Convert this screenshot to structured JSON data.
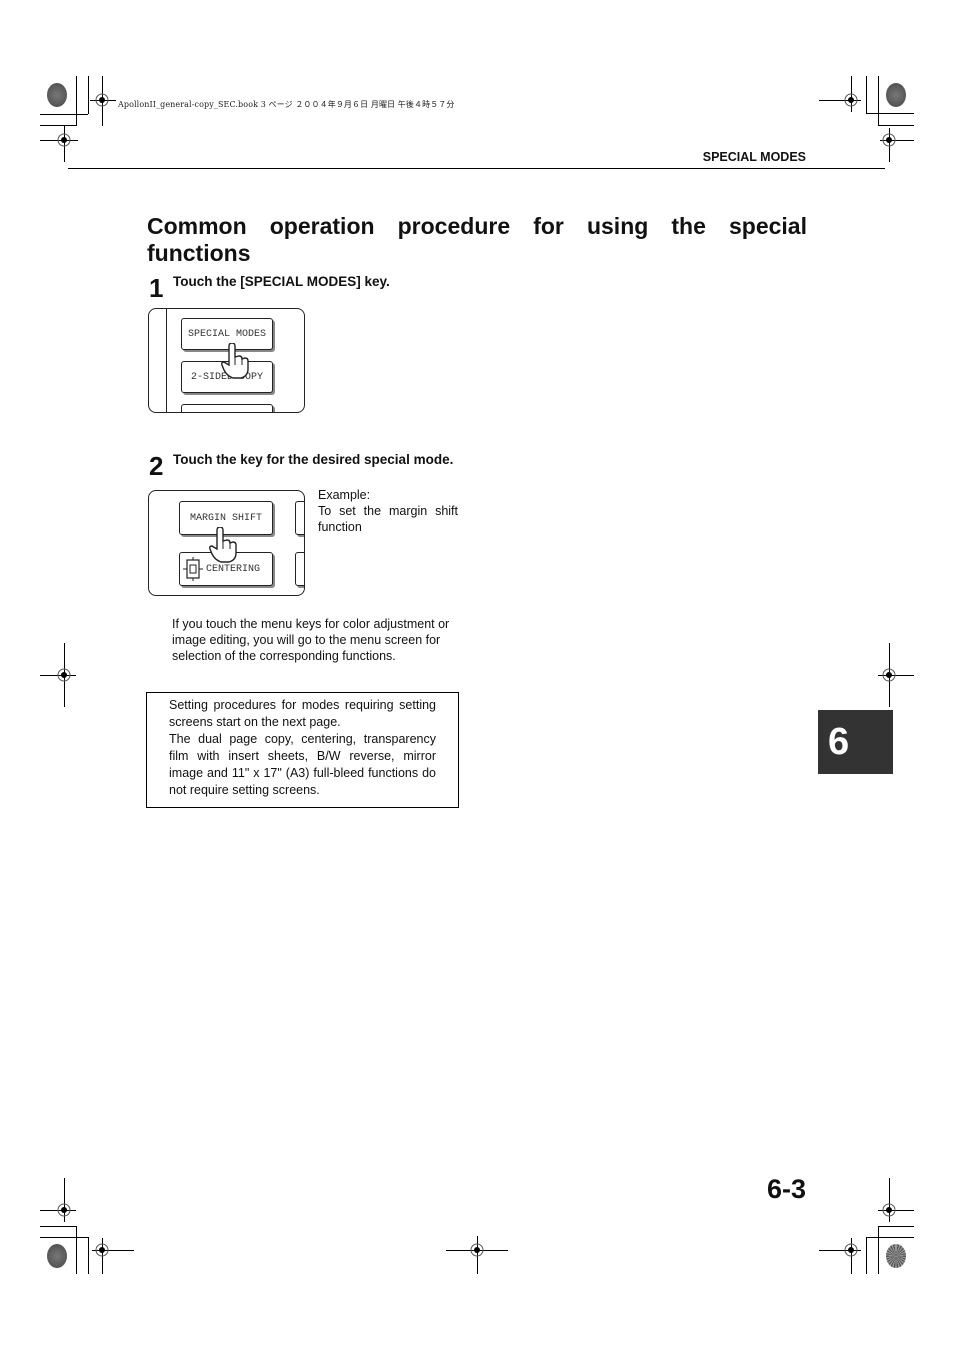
{
  "print_info": {
    "book_line": "ApollonII_general-copy_SEC.book  3 ページ  ２００４年９月６日  月曜日  午後４時５７分"
  },
  "header": {
    "running_head": "SPECIAL MODES"
  },
  "title": {
    "line1": "Common operation procedure for using the special",
    "line2": "functions"
  },
  "steps": [
    {
      "number": "1",
      "text": "Touch the [SPECIAL MODES] key.",
      "illustration": {
        "keys": [
          "SPECIAL MODES",
          "2-SIDED COPY"
        ],
        "icon": "hand-pointer-icon"
      }
    },
    {
      "number": "2",
      "text": "Touch the key for the desired special mode.",
      "illustration": {
        "keys": [
          "MARGIN SHIFT",
          "CENTERING"
        ],
        "icon": "hand-pointer-icon"
      },
      "example_label": "Example:",
      "example_text": "To set the margin shift function"
    }
  ],
  "note": "If you touch the menu keys for color adjustment or image editing, you will go to the menu screen for selection of the corresponding functions.",
  "info_box": {
    "line1": "Setting procedures for modes requiring setting screens start on the next page.",
    "line2": "The dual page copy, centering, transparency film with insert sheets, B/W reverse, mirror image and 11\" x 17\" (A3) full-bleed functions do not require setting screens."
  },
  "chapter_tab": {
    "label": "6",
    "color": "#333333"
  },
  "page_number": "6-3"
}
